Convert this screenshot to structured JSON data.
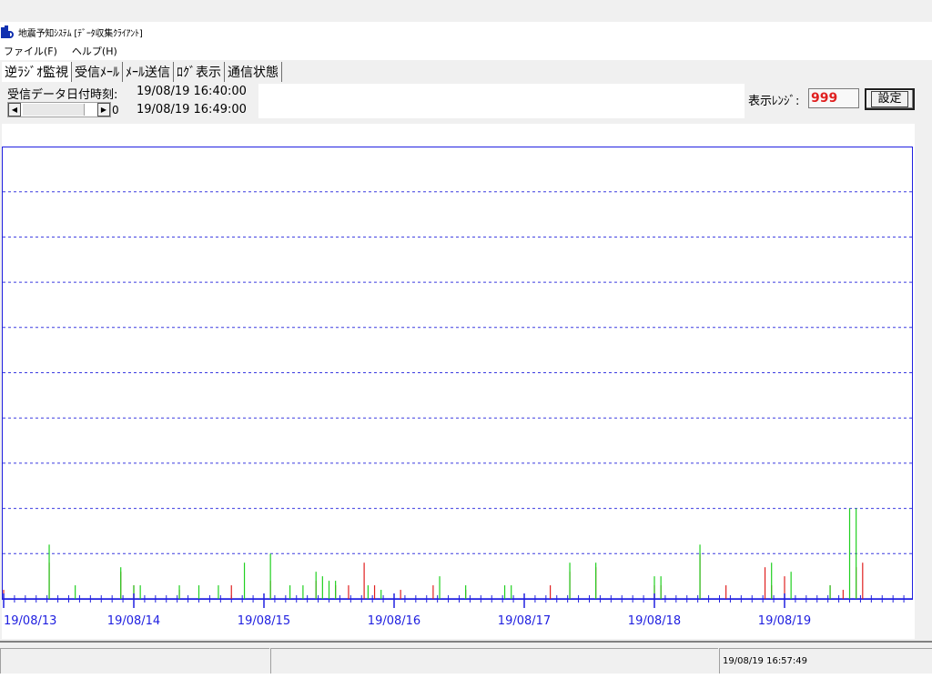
{
  "window": {
    "title": "地震予知ｼｽﾃﾑ [ﾃﾞｰﾀ収集ｸﾗｲｱﾝﾄ]"
  },
  "menu": {
    "items": [
      "ファイル(F)",
      "ヘルプ(H)"
    ]
  },
  "tabs": [
    {
      "label": "逆ﾗｼﾞｵ監視",
      "active": true
    },
    {
      "label": "受信ﾒｰﾙ",
      "active": false
    },
    {
      "label": "ﾒｰﾙ送信",
      "active": false
    },
    {
      "label": "ﾛｸﾞ表示",
      "active": false
    },
    {
      "label": "通信状態",
      "active": false
    }
  ],
  "info": {
    "received_label": "受信データ日付時刻:",
    "start_time": "19/08/19 16:40:00",
    "end_time": "19/08/19 16:49:00",
    "scroll_value": "0",
    "range_label": "表示ﾚﾝｼﾞ:",
    "range_value": "999",
    "set_button": "設定"
  },
  "status": {
    "timestamp": "19/08/19 16:57:49"
  },
  "colors": {
    "axis": "#2020e0",
    "grid": "#3a3ae0",
    "spike_red": "#e02020",
    "spike_green": "#20d020",
    "range_text": "#e02020"
  },
  "chart_data": {
    "type": "bar",
    "title": "",
    "xlabel": "",
    "ylabel": "",
    "x_ticks": [
      "19/08/13",
      "19/08/14",
      "19/08/15",
      "19/08/16",
      "19/08/17",
      "19/08/18",
      "19/08/19"
    ],
    "x_range_days": [
      0,
      7
    ],
    "ylim": [
      0,
      10
    ],
    "grid": "horizontal-dashed",
    "series": [
      {
        "color": "red",
        "points": [
          [
            0.0,
            0.2
          ],
          [
            0.35,
            0.8
          ],
          [
            0.9,
            0.6
          ],
          [
            1.0,
            0.3
          ],
          [
            1.35,
            0.2
          ],
          [
            1.75,
            0.3
          ],
          [
            2.05,
            0.4
          ],
          [
            2.4,
            0.4
          ],
          [
            2.55,
            0.3
          ],
          [
            2.65,
            0.3
          ],
          [
            2.77,
            0.8
          ],
          [
            2.85,
            0.3
          ],
          [
            3.05,
            0.2
          ],
          [
            3.3,
            0.3
          ],
          [
            3.55,
            0.2
          ],
          [
            4.2,
            0.3
          ],
          [
            4.35,
            0.6
          ],
          [
            4.55,
            0.7
          ],
          [
            5.0,
            0.3
          ],
          [
            5.05,
            0.3
          ],
          [
            5.35,
            1.0
          ],
          [
            5.55,
            0.3
          ],
          [
            5.85,
            0.7
          ],
          [
            5.9,
            0.3
          ],
          [
            6.0,
            0.5
          ],
          [
            6.35,
            0.3
          ],
          [
            6.45,
            0.2
          ],
          [
            6.55,
            0.7
          ],
          [
            6.6,
            0.8
          ]
        ]
      },
      {
        "color": "green",
        "points": [
          [
            0.35,
            1.2
          ],
          [
            0.55,
            0.3
          ],
          [
            0.9,
            0.7
          ],
          [
            1.0,
            0.3
          ],
          [
            1.05,
            0.3
          ],
          [
            1.35,
            0.3
          ],
          [
            1.5,
            0.3
          ],
          [
            1.65,
            0.3
          ],
          [
            1.85,
            0.8
          ],
          [
            2.05,
            1.0
          ],
          [
            2.2,
            0.3
          ],
          [
            2.3,
            0.3
          ],
          [
            2.4,
            0.6
          ],
          [
            2.45,
            0.5
          ],
          [
            2.5,
            0.4
          ],
          [
            2.55,
            0.4
          ],
          [
            2.8,
            0.3
          ],
          [
            2.9,
            0.2
          ],
          [
            3.35,
            0.5
          ],
          [
            3.55,
            0.3
          ],
          [
            3.85,
            0.3
          ],
          [
            3.9,
            0.3
          ],
          [
            4.35,
            0.8
          ],
          [
            4.55,
            0.8
          ],
          [
            5.0,
            0.5
          ],
          [
            5.05,
            0.5
          ],
          [
            5.35,
            1.2
          ],
          [
            5.9,
            0.8
          ],
          [
            6.05,
            0.6
          ],
          [
            6.35,
            0.3
          ],
          [
            6.5,
            2.0
          ],
          [
            6.55,
            2.0
          ]
        ]
      }
    ]
  }
}
